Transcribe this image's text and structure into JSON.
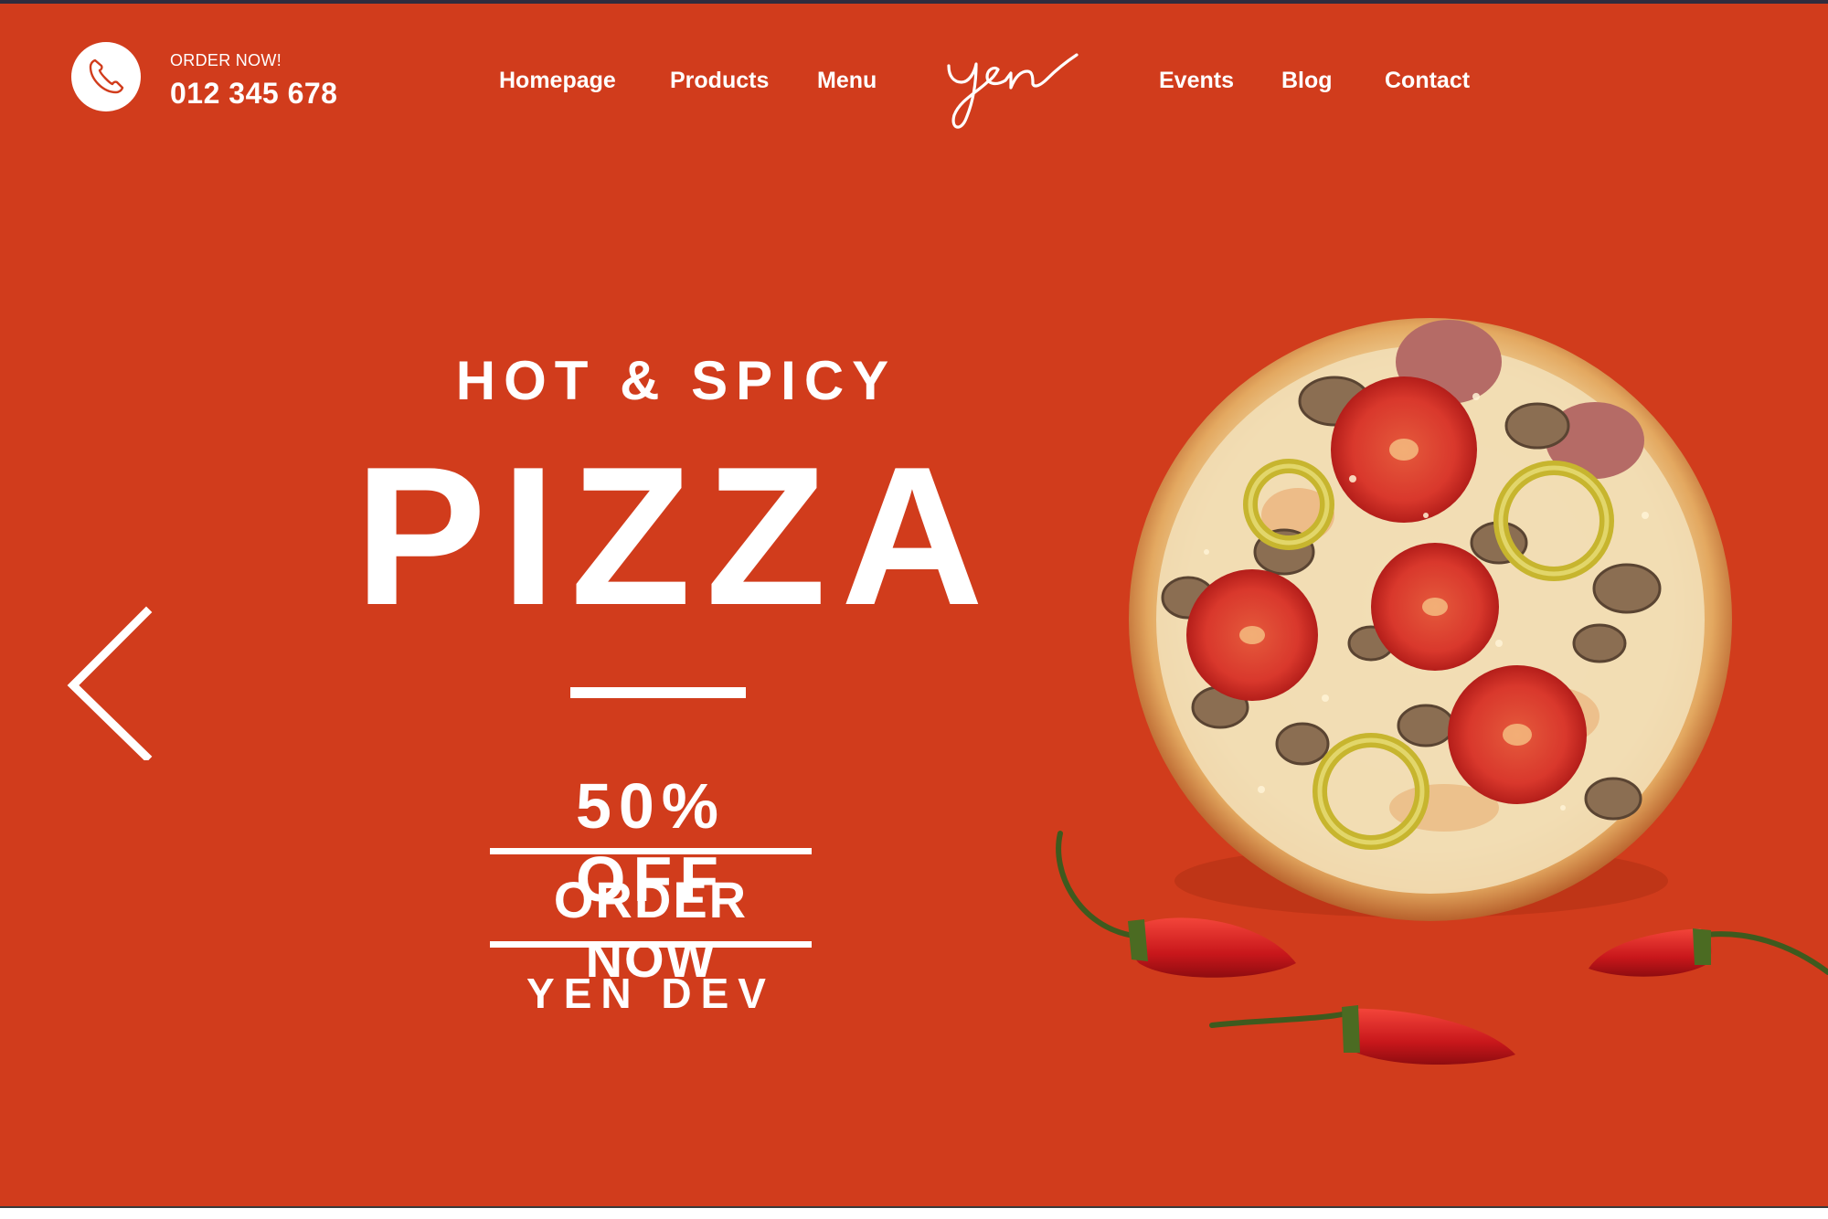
{
  "header": {
    "order_label": "ORDER NOW!",
    "phone": "012 345 678",
    "logo_text": "yen",
    "nav": [
      "Homepage",
      "Products",
      "Menu",
      "Events",
      "Blog",
      "Contact"
    ]
  },
  "hero": {
    "kicker": "HOT & SPICY",
    "title": "PIZZA",
    "discount": "50% OFF",
    "cta": "ORDER NOW",
    "brand": "YEN DEV"
  },
  "icons": {
    "phone": "phone-icon",
    "prev": "chevron-left-icon",
    "pizza": "pizza-image",
    "chili": "chili-pepper-image"
  },
  "colors": {
    "background": "#d13c1c",
    "text": "#ffffff",
    "top_border": "#2f2c3e"
  }
}
